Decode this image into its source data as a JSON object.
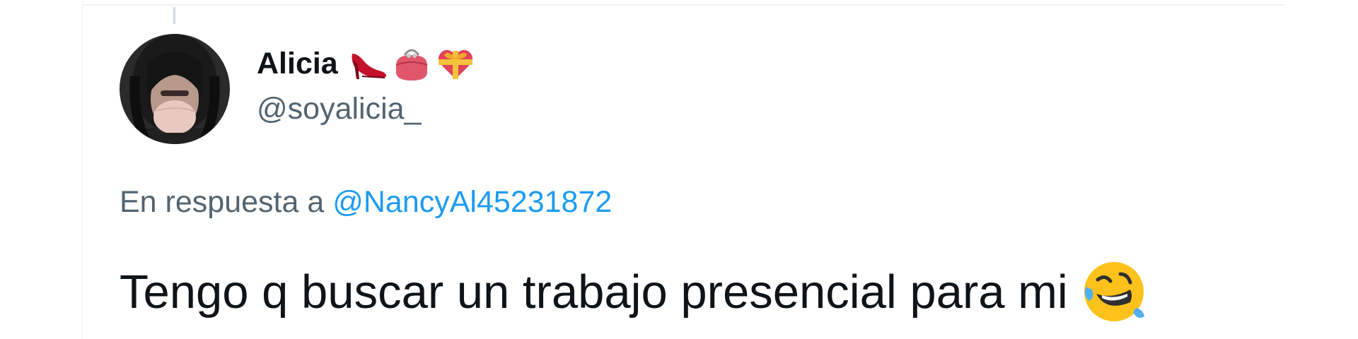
{
  "tweet": {
    "author": {
      "display_name": "Alicia",
      "handle": "@soyalicia_",
      "name_emojis": [
        "high-heel-shoe-icon",
        "purse-icon",
        "heart-with-ribbon-icon"
      ]
    },
    "reply_prefix": "En respuesta a",
    "reply_to": "@NancyAl45231872",
    "text": "Tengo q buscar un trabajo presencial para mi",
    "text_emoji": "rolling-on-floor-laughing-icon"
  },
  "colors": {
    "link": "#1d9bf0",
    "secondary_text": "#536471",
    "primary_text": "#0f1419",
    "border": "#eff3f4"
  }
}
